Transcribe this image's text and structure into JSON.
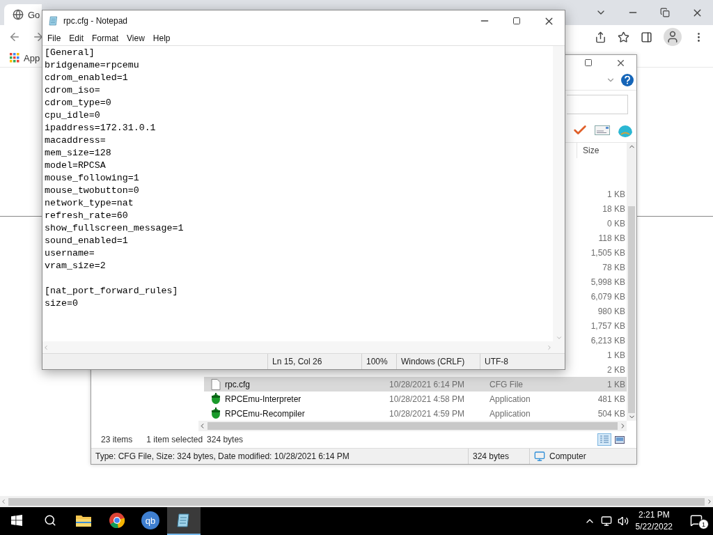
{
  "browser": {
    "tab": {
      "title": "Go",
      "selected": true
    },
    "bookmarks": [
      {
        "label": "App"
      }
    ]
  },
  "explorer": {
    "column_header": "Size",
    "rows": [
      {
        "size": "1 KB",
        "selected": false
      },
      {
        "size": "18 KB",
        "selected": false
      },
      {
        "size": "0 KB",
        "selected": false
      },
      {
        "size": "118 KB",
        "selected": false
      },
      {
        "size": "1,505 KB",
        "selected": false
      },
      {
        "size": "78 KB",
        "selected": false
      },
      {
        "size": "5,998 KB",
        "selected": false
      },
      {
        "size": "6,079 KB",
        "selected": false
      },
      {
        "size": "980 KB",
        "selected": false
      },
      {
        "size": "1,757 KB",
        "selected": false
      },
      {
        "size": "6,213 KB",
        "selected": false
      },
      {
        "size": "1 KB",
        "selected": false
      },
      {
        "size": "2 KB",
        "selected": false
      },
      {
        "kind": "file",
        "name": "rpc.cfg",
        "date": "10/28/2021 6:14 PM",
        "type": "CFG File",
        "size": "1 KB",
        "selected": true
      },
      {
        "kind": "app",
        "name": "RPCEmu-Interpreter",
        "date": "10/28/2021 4:58 PM",
        "type": "Application",
        "size": "481 KB",
        "selected": false
      },
      {
        "kind": "app",
        "name": "RPCEmu-Recompiler",
        "date": "10/28/2021 4:59 PM",
        "type": "Application",
        "size": "504 KB",
        "selected": false
      }
    ],
    "item_count": "23 items",
    "selection": "1 item selected",
    "selection_size": "324 bytes",
    "views": [
      {
        "kind": "details",
        "selected": true
      },
      {
        "kind": "preview",
        "selected": false
      }
    ],
    "status": {
      "details": "Type: CFG File, Size: 324 bytes, Date modified: 10/28/2021 6:14 PM",
      "size": "324 bytes",
      "location": "Computer"
    }
  },
  "notepad": {
    "title": "rpc.cfg - Notepad",
    "menu": [
      "File",
      "Edit",
      "Format",
      "View",
      "Help"
    ],
    "text": "[General]\nbridgename=rpcemu\ncdrom_enabled=1\ncdrom_iso=\ncdrom_type=0\ncpu_idle=0\nipaddress=172.31.0.1\nmacaddress=\nmem_size=128\nmodel=RPCSA\nmouse_following=1\nmouse_twobutton=0\nnetwork_type=nat\nrefresh_rate=60\nshow_fullscreen_message=1\nsound_enabled=1\nusername=\nvram_size=2\n\n[nat_port_forward_rules]\nsize=0",
    "status": {
      "position": "Ln 15, Col 26",
      "zoom": "100%",
      "line_endings": "Windows (CRLF)",
      "encoding": "UTF-8"
    }
  },
  "taskbar": {
    "apps": [
      {
        "kind": "explorer",
        "selected": false
      },
      {
        "kind": "chrome",
        "selected": false
      },
      {
        "kind": "qbittorrent",
        "label": "qb",
        "selected": false
      },
      {
        "kind": "notepad",
        "selected": true
      }
    ],
    "time": "2:21 PM",
    "date": "5/22/2022",
    "notifications": "1"
  }
}
